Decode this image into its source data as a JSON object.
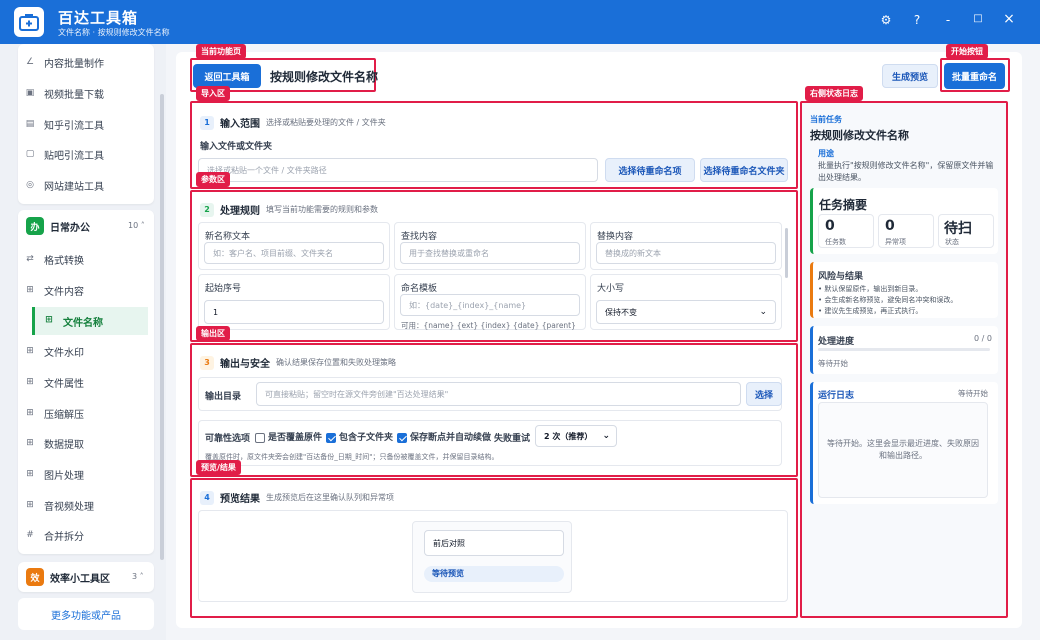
{
  "app": {
    "title": "百达工具箱",
    "subtitle": "文件名称 · 按规则修改文件名称"
  },
  "window": {
    "settings": "⚙",
    "help": "?",
    "minimize": "-",
    "maximize": "□",
    "close": "×"
  },
  "sidebar": {
    "top_items": [
      {
        "label": "内容批量制作"
      },
      {
        "label": "视频批量下载"
      },
      {
        "label": "知乎引流工具"
      },
      {
        "label": "贴吧引流工具"
      },
      {
        "label": "网站建站工具"
      }
    ],
    "group_daily": {
      "badge": "办",
      "title": "日常办公",
      "count": "10 ˄"
    },
    "daily_items": [
      {
        "label": "格式转换"
      },
      {
        "label": "文件内容"
      },
      {
        "label": "文件名称"
      },
      {
        "label": "文件水印"
      },
      {
        "label": "文件属性"
      },
      {
        "label": "压缩解压"
      },
      {
        "label": "数据提取"
      },
      {
        "label": "图片处理"
      },
      {
        "label": "音视频处理"
      },
      {
        "label": "合并拆分"
      }
    ],
    "group_small": {
      "badge": "效",
      "title": "效率小工具区",
      "count": "3 ˄"
    },
    "more": "更多功能或产品"
  },
  "tags": {
    "current_page": "当前功能页",
    "start_button": "开始按钮",
    "import": "导入区",
    "status_log": "右侧状态日志",
    "params": "参数区",
    "output": "输出区",
    "preview": "预览/结果"
  },
  "header": {
    "back": "返回工具箱",
    "title": "按规则修改文件名称",
    "preview_btn": "生成预览",
    "rename_btn": "批量重命名"
  },
  "s1": {
    "num": "1",
    "title": "输入范围",
    "hint": "选择或粘贴要处理的文件 / 文件夹",
    "field_label": "输入文件或文件夹",
    "placeholder": "选择或粘贴一个文件 / 文件夹路径",
    "btn_files": "选择待重命名项",
    "btn_folder": "选择待重命名文件夹"
  },
  "s2": {
    "num": "2",
    "title": "处理规则",
    "hint": "填写当前功能需要的规则和参数",
    "new_name_label": "新名称文本",
    "new_name_ph": "如：客户名、项目前缀、文件夹名",
    "find_label": "查找内容",
    "find_ph": "用于查找替换或重命名",
    "replace_label": "替换内容",
    "replace_ph": "替换成的新文本",
    "start_label": "起始序号",
    "start_value": "1",
    "template_label": "命名模板",
    "template_ph": "如：{date}_{index}_{name}",
    "template_help": "可用：{name} {ext} {index} {date} {parent}",
    "case_label": "大小写",
    "case_value": "保持不变"
  },
  "s3": {
    "num": "3",
    "title": "输出与安全",
    "hint": "确认结果保存位置和失败处理策略",
    "dir_label": "输出目录",
    "dir_ph": "可直接粘贴；留空时在源文件旁创建\"百达处理结果\"",
    "dir_btn": "选择",
    "rel_label": "可靠性选项",
    "opt1": "是否覆盖原件",
    "opt2": "包含子文件夹",
    "opt3": "保存断点并自动续做",
    "retry_label": "失败重试",
    "retry_value": "2 次（推荐）",
    "note": "覆盖原件时，原文件夹旁会创建\"百达备份_日期_时间\"；只备份被覆盖文件，并保留目录结构。"
  },
  "s4": {
    "num": "4",
    "title": "预览结果",
    "hint": "生成预览后在这里确认队列和异常项",
    "compare": "前后对照",
    "waiting": "等待预览"
  },
  "right": {
    "cur_label": "当前任务",
    "cur_title": "按规则修改文件名称",
    "use_label": "用途",
    "use_text": "批量执行\"按规则修改文件名称\"，保留原文件并输出处理结果。",
    "summary_title": "任务摘要",
    "sum1_val": "0",
    "sum1_lbl": "任务数",
    "sum2_val": "0",
    "sum2_lbl": "异常项",
    "sum3_val": "待扫",
    "sum3_lbl": "状态",
    "risk_title": "风险与结果",
    "risk1": "默认保留原件，输出到新目录。",
    "risk2": "会生成新名称预览，避免同名冲突和误改。",
    "risk3": "建议先生成预览，再正式执行。",
    "progress_title": "处理进度",
    "progress_count": "0 / 0",
    "progress_status": "等待开始",
    "progress": 0,
    "log_title": "运行日志",
    "log_status": "等待开始",
    "log_text": "等待开始。这里会显示最近进度、失败原因和输出路径。"
  }
}
